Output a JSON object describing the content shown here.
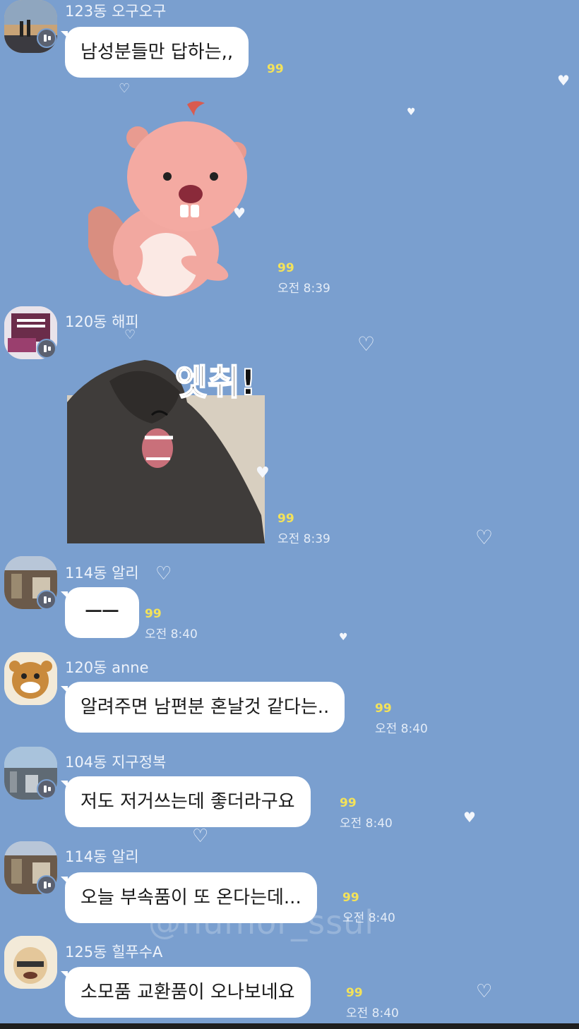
{
  "messages": [
    {
      "sender": "123동 오구오구",
      "text": "남성분들만 답하는,,",
      "unread": "99"
    },
    {
      "sticker": "beaver-sticker",
      "unread": "99",
      "time": "오전 8:39"
    },
    {
      "sender": "120동 해피",
      "sticker_text": "엣취!",
      "unread": "99",
      "time": "오전 8:39"
    },
    {
      "sender": "114동 알리",
      "text": "ㅡㅡ",
      "unread": "99",
      "time": "오전 8:40"
    },
    {
      "sender": "120동 anne",
      "text": "알려주면 남편분 혼날것 같다는..",
      "unread": "99",
      "time": "오전 8:40"
    },
    {
      "sender": "104동 지구정복",
      "text": "저도 저거쓰는데 좋더라구요",
      "unread": "99",
      "time": "오전 8:40"
    },
    {
      "sender": "114동 알리",
      "text": "오늘 부속품이 또 온다는데...",
      "unread": "99",
      "time": "오전 8:40"
    },
    {
      "sender": "125동 힐푸수A",
      "text": "소모품 교환품이 오나보네요",
      "unread": "99",
      "time": "오전 8:40"
    }
  ],
  "watermark": "@humor_ssul",
  "colors": {
    "background": "#7a9fcf",
    "bubble": "#ffffff",
    "unread": "#f3e25a"
  }
}
